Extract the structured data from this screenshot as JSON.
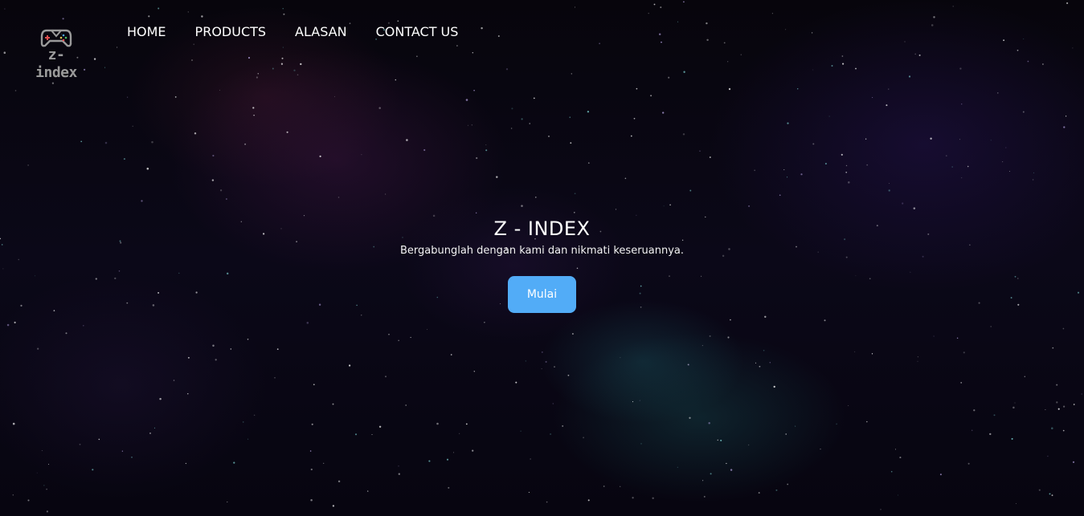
{
  "brand": {
    "logo_text": "z-index",
    "logo_icon": "gamepad-icon"
  },
  "nav": {
    "items": [
      {
        "label": "HOME"
      },
      {
        "label": "PRODUCTS"
      },
      {
        "label": "ALASAN"
      },
      {
        "label": "CONTACT US"
      }
    ]
  },
  "hero": {
    "title": "Z - INDEX",
    "subtitle": "Bergabunglah dengan kami dan nikmati keseruannya.",
    "cta_label": "Mulai"
  },
  "colors": {
    "accent": "#52acf7",
    "background": "#07050c",
    "text": "#ffffff"
  }
}
